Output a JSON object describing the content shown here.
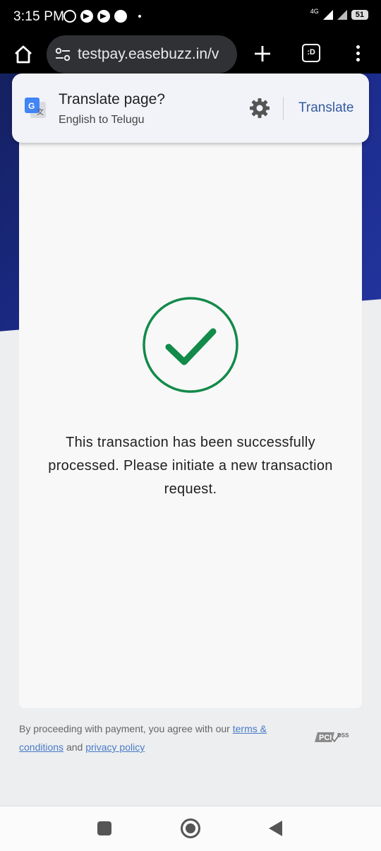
{
  "status_bar": {
    "time": "3:15 PM",
    "network": "4G",
    "battery": "51"
  },
  "browser": {
    "url": "testpay.easebuzz.in/v",
    "tabs_label": ":D"
  },
  "translate_prompt": {
    "title": "Translate page?",
    "subtitle": "English to Telugu",
    "button": "Translate"
  },
  "result": {
    "message": "This transaction has been successfully processed. Please initiate a new transaction request."
  },
  "footer": {
    "text_before": "By proceeding with payment, you agree with our",
    "terms_link": "terms & conditions",
    "and_text": "and",
    "privacy_link": "privacy policy"
  },
  "colors": {
    "success_green": "#128a4a",
    "header_blue": "#1b2b8a",
    "link_blue": "#4a7ac7"
  }
}
